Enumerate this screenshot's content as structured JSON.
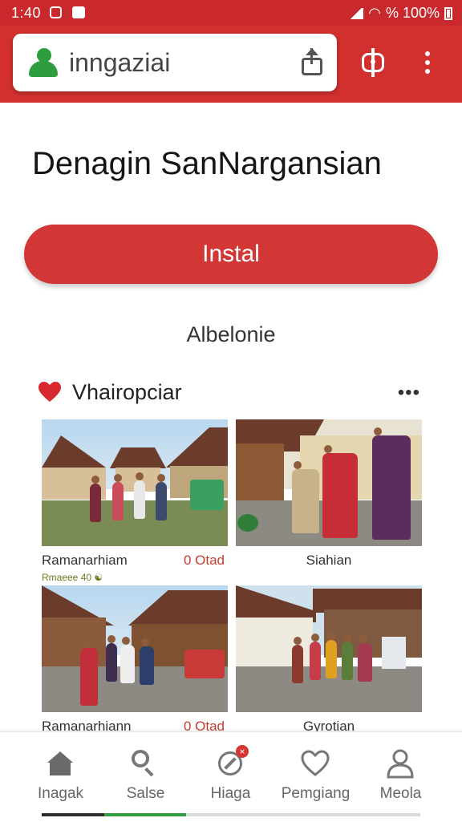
{
  "status_bar": {
    "time": "1:40",
    "battery_text": "% 100%"
  },
  "browser": {
    "url_text": "inngaziai",
    "accent": "#d2302f"
  },
  "app": {
    "title": "Denagin SanNargansian",
    "install_label": "Instal",
    "sub_label": "Albelonie"
  },
  "section": {
    "title": "Vhairopciar",
    "more_label": "•••"
  },
  "cards": [
    {
      "left": "Ramanarhiam",
      "right": "0 Otad",
      "center": "",
      "tags": "Rmaeee 40 ☯"
    },
    {
      "left": "",
      "right": "",
      "center": "Siahian",
      "tags": ""
    },
    {
      "left": "Ramanarhiann",
      "right": "0 Otad",
      "center": "",
      "tags": ""
    },
    {
      "left": "",
      "right": "",
      "center": "Gyrotian",
      "tags": ""
    }
  ],
  "bottom_nav": [
    {
      "label": "Inagak",
      "icon": "home-icon"
    },
    {
      "label": "Salse",
      "icon": "search-icon"
    },
    {
      "label": "Hiaga",
      "icon": "edit-icon"
    },
    {
      "label": "Pemgiang",
      "icon": "heart-icon"
    },
    {
      "label": "Meola",
      "icon": "profile-icon"
    }
  ],
  "scroll_progress": 0.3
}
